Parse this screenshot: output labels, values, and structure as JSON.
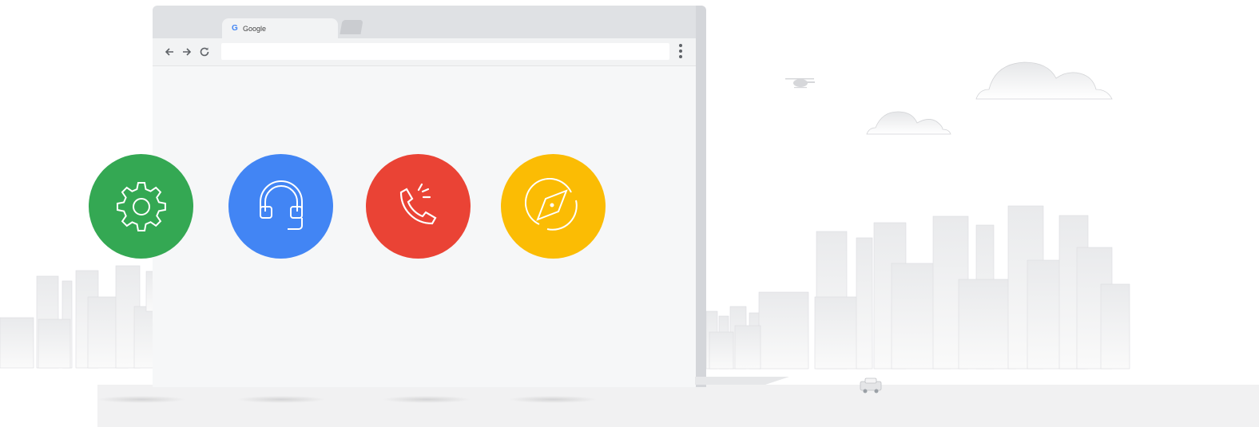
{
  "browser": {
    "tab": {
      "logo": "G",
      "title": "Google"
    },
    "toolbar": {
      "back_icon": "arrow-left-icon",
      "forward_icon": "arrow-right-icon",
      "reload_icon": "reload-icon",
      "address_value": "",
      "menu_icon": "kebab-menu-icon"
    }
  },
  "features": [
    {
      "icon": "gear-icon",
      "color": "#34a853"
    },
    {
      "icon": "headset-icon",
      "color": "#4285f4"
    },
    {
      "icon": "phone-ringing-icon",
      "color": "#ea4335"
    },
    {
      "icon": "compass-icon",
      "color": "#fbbc04"
    }
  ],
  "scene": {
    "sky_items": [
      "helicopter",
      "cloud",
      "cloud"
    ],
    "street_items": [
      "car"
    ],
    "colors": {
      "ground": "#f1f1f2",
      "building": "#eeeff1",
      "frame": "#dfe1e4"
    }
  }
}
